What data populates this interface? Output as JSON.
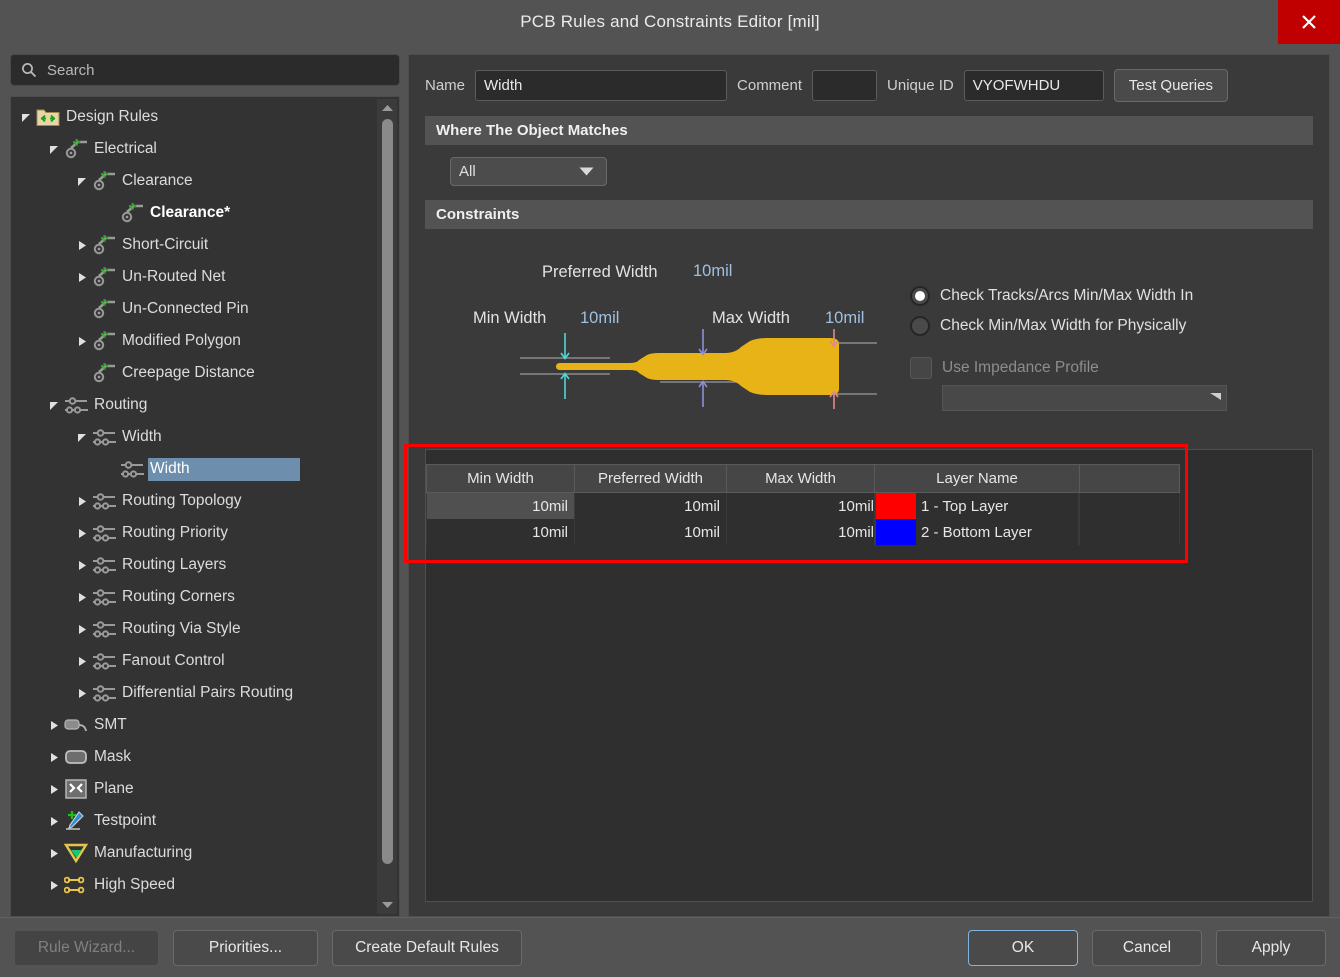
{
  "window": {
    "title": "PCB Rules and Constraints Editor [mil]",
    "close_icon": "close-icon"
  },
  "search": {
    "placeholder": "Search",
    "icon": "search-icon"
  },
  "tree": {
    "items": [
      {
        "label": "Design Rules",
        "depth": 0,
        "icon": "design-rules-folder-icon",
        "twisty": "expanded"
      },
      {
        "label": "Electrical",
        "depth": 1,
        "icon": "electrical-rule-icon",
        "twisty": "expanded"
      },
      {
        "label": "Clearance",
        "depth": 2,
        "icon": "electrical-rule-icon",
        "twisty": "expanded"
      },
      {
        "label": "Clearance*",
        "depth": 3,
        "icon": "electrical-rule-icon",
        "twisty": "none",
        "bold": true
      },
      {
        "label": "Short-Circuit",
        "depth": 2,
        "icon": "electrical-rule-icon",
        "twisty": "collapsed"
      },
      {
        "label": "Un-Routed Net",
        "depth": 2,
        "icon": "electrical-rule-icon",
        "twisty": "collapsed"
      },
      {
        "label": "Un-Connected Pin",
        "depth": 2,
        "icon": "electrical-rule-icon",
        "twisty": "none"
      },
      {
        "label": "Modified Polygon",
        "depth": 2,
        "icon": "electrical-rule-icon",
        "twisty": "collapsed"
      },
      {
        "label": "Creepage Distance",
        "depth": 2,
        "icon": "electrical-rule-icon",
        "twisty": "none"
      },
      {
        "label": "Routing",
        "depth": 1,
        "icon": "routing-rule-icon",
        "twisty": "expanded"
      },
      {
        "label": "Width",
        "depth": 2,
        "icon": "routing-rule-icon",
        "twisty": "expanded"
      },
      {
        "label": "Width",
        "depth": 3,
        "icon": "routing-rule-icon",
        "twisty": "none",
        "selected": true
      },
      {
        "label": "Routing Topology",
        "depth": 2,
        "icon": "routing-rule-icon",
        "twisty": "collapsed"
      },
      {
        "label": "Routing Priority",
        "depth": 2,
        "icon": "routing-rule-icon",
        "twisty": "collapsed"
      },
      {
        "label": "Routing Layers",
        "depth": 2,
        "icon": "routing-rule-icon",
        "twisty": "collapsed"
      },
      {
        "label": "Routing Corners",
        "depth": 2,
        "icon": "routing-rule-icon",
        "twisty": "collapsed"
      },
      {
        "label": "Routing Via Style",
        "depth": 2,
        "icon": "routing-rule-icon",
        "twisty": "collapsed"
      },
      {
        "label": "Fanout Control",
        "depth": 2,
        "icon": "routing-rule-icon",
        "twisty": "collapsed"
      },
      {
        "label": "Differential Pairs Routing",
        "depth": 2,
        "icon": "routing-rule-icon",
        "twisty": "collapsed"
      },
      {
        "label": "SMT",
        "depth": 1,
        "icon": "smt-icon",
        "twisty": "collapsed"
      },
      {
        "label": "Mask",
        "depth": 1,
        "icon": "mask-icon",
        "twisty": "collapsed"
      },
      {
        "label": "Plane",
        "depth": 1,
        "icon": "plane-icon",
        "twisty": "collapsed"
      },
      {
        "label": "Testpoint",
        "depth": 1,
        "icon": "testpoint-icon",
        "twisty": "collapsed"
      },
      {
        "label": "Manufacturing",
        "depth": 1,
        "icon": "manufacturing-icon",
        "twisty": "collapsed"
      },
      {
        "label": "High Speed",
        "depth": 1,
        "icon": "high-speed-icon",
        "twisty": "collapsed"
      }
    ]
  },
  "form": {
    "name_label": "Name",
    "name_value": "Width",
    "comment_label": "Comment",
    "comment_value": "",
    "unique_id_label": "Unique ID",
    "unique_id_value": "VYOFWHDU",
    "test_queries_label": "Test Queries"
  },
  "where_matches": {
    "header": "Where The Object Matches",
    "scope_value": "All"
  },
  "constraints": {
    "header": "Constraints",
    "diagram": {
      "preferred_label": "Preferred Width",
      "preferred_value": "10mil",
      "min_label": "Min Width",
      "min_value": "10mil",
      "max_label": "Max Width",
      "max_value": "10mil",
      "track_color": "#e8b317",
      "min_arrow_color": "#4fd8d8",
      "preferred_arrow_color": "#8f8fd8",
      "max_arrow_color": "#e08a8a"
    },
    "options": {
      "radio_1": "Check Tracks/Arcs Min/Max Width In",
      "radio_2": "Check Min/Max Width for Physically",
      "radio_selected": 1,
      "impedance_label": "Use Impedance Profile",
      "impedance_checked": false,
      "impedance_value": ""
    },
    "table": {
      "columns": [
        "Min Width",
        "Preferred Width",
        "Max Width",
        "Layer Name"
      ],
      "rows": [
        {
          "min": "10mil",
          "preferred": "10mil",
          "max": "10mil",
          "layer": "1 - Top Layer",
          "color": "#ff0000",
          "selected": true
        },
        {
          "min": "10mil",
          "preferred": "10mil",
          "max": "10mil",
          "layer": "2 - Bottom Layer",
          "color": "#0000ff",
          "selected": false
        }
      ]
    },
    "highlight_color": "#ff0000"
  },
  "footer": {
    "rule_wizard": "Rule Wizard...",
    "rule_wizard_accel": "R",
    "priorities": "Priorities...",
    "priorities_accel": "P",
    "create_default_rules": "Create Default Rules",
    "create_default_accel": "C",
    "ok": "OK",
    "cancel": "Cancel",
    "apply": "Apply"
  }
}
